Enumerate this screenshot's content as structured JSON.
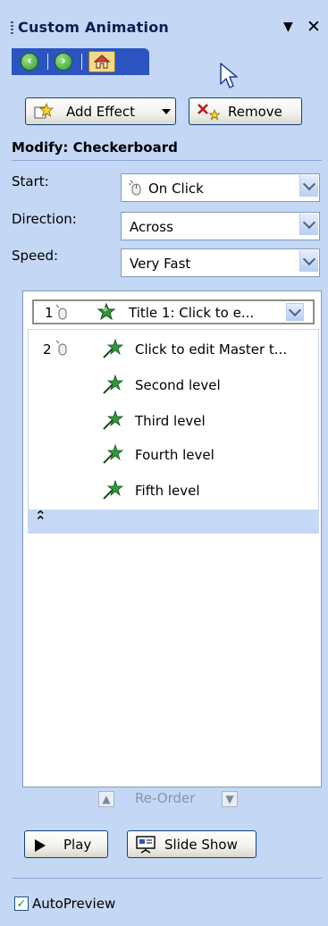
{
  "pane": {
    "title": "Custom Animation",
    "menu_glyph": "▼",
    "close_glyph": "✕"
  },
  "nav": {
    "icons": [
      "back-icon",
      "forward-icon",
      "home-icon"
    ]
  },
  "toolbar": {
    "add_effect_label": "Add Effect",
    "remove_label": "Remove"
  },
  "modify": {
    "heading": "Modify: Checkerboard",
    "start": {
      "label": "Start:",
      "value": "On Click"
    },
    "direction": {
      "label": "Direction:",
      "value": "Across"
    },
    "speed": {
      "label": "Speed:",
      "value": "Very Fast"
    }
  },
  "list": {
    "items": [
      {
        "num": "1",
        "text": "Title 1: Click to e...",
        "selected": true
      },
      {
        "num": "2",
        "text": "Click to edit Master t..."
      },
      {
        "num": "",
        "text": "Second level"
      },
      {
        "num": "",
        "text": "Third level"
      },
      {
        "num": "",
        "text": "Fourth level"
      },
      {
        "num": "",
        "text": "Fifth level"
      }
    ],
    "collapse_glyph": "⌃"
  },
  "reorder": {
    "label": "Re-Order"
  },
  "actions": {
    "play_label": "Play",
    "slideshow_label": "Slide Show"
  },
  "autopreview": {
    "label": "AutoPreview",
    "checked": true
  },
  "colors": {
    "pane_bg": "#c4d7f4",
    "nav_bar": "#2b54c0",
    "selection": "#ccdcf5",
    "effect_star": "#1f7a33"
  }
}
